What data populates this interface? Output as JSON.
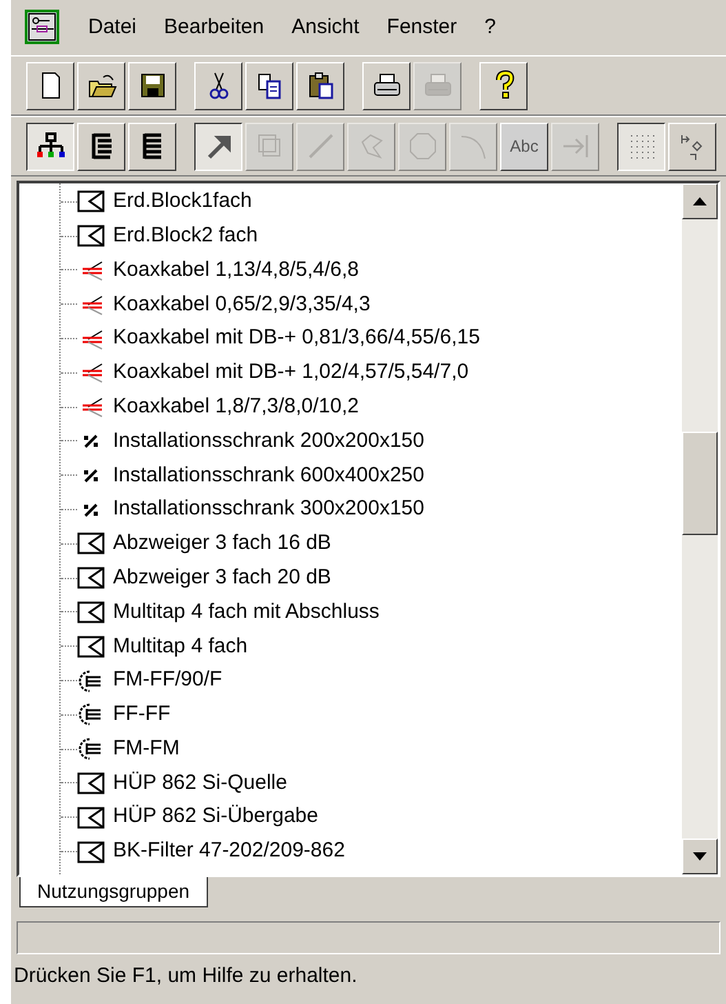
{
  "menu": [
    "Datei",
    "Bearbeiten",
    "Ansicht",
    "Fenster",
    "?"
  ],
  "toolbar_main": [
    [
      {
        "kind": "new",
        "disabled": false
      },
      {
        "kind": "open",
        "disabled": false
      },
      {
        "kind": "save",
        "disabled": false
      }
    ],
    [
      {
        "kind": "cut",
        "disabled": false
      },
      {
        "kind": "copy",
        "disabled": false
      },
      {
        "kind": "paste",
        "disabled": false
      }
    ],
    [
      {
        "kind": "print",
        "disabled": false
      },
      {
        "kind": "print",
        "disabled": true
      }
    ],
    [
      {
        "kind": "help",
        "disabled": false
      }
    ]
  ],
  "toolbar_draw": [
    [
      {
        "kind": "tree",
        "pressed": true,
        "disabled": false
      },
      {
        "kind": "list",
        "pressed": false,
        "disabled": false
      },
      {
        "kind": "bars",
        "pressed": false,
        "disabled": false
      }
    ],
    [
      {
        "kind": "pointer",
        "pressed": true,
        "disabled": false
      },
      {
        "kind": "frames",
        "pressed": false,
        "disabled": true
      },
      {
        "kind": "line",
        "pressed": false,
        "disabled": true
      },
      {
        "kind": "polygon",
        "pressed": false,
        "disabled": true
      },
      {
        "kind": "octagon",
        "pressed": false,
        "disabled": true
      },
      {
        "kind": "arc",
        "pressed": false,
        "disabled": true
      },
      {
        "kind": "text",
        "pressed": false,
        "disabled": true,
        "label": "Abc"
      },
      {
        "kind": "arrow",
        "pressed": false,
        "disabled": true
      }
    ],
    [
      {
        "kind": "grid",
        "pressed": true,
        "disabled": false
      },
      {
        "kind": "snap",
        "pressed": false,
        "disabled": false
      }
    ]
  ],
  "tree": {
    "items": [
      {
        "kind": "block",
        "label": "Erd.Block1fach"
      },
      {
        "kind": "block",
        "label": "Erd.Block2 fach"
      },
      {
        "kind": "cable",
        "label": "Koaxkabel 1,13/4,8/5,4/6,8"
      },
      {
        "kind": "cable",
        "label": "Koaxkabel 0,65/2,9/3,35/4,3"
      },
      {
        "kind": "cable",
        "label": "Koaxkabel mit DB-+ 0,81/3,66/4,55/6,15"
      },
      {
        "kind": "cable",
        "label": "Koaxkabel mit DB-+ 1,02/4,57/5,54/7,0"
      },
      {
        "kind": "cable",
        "label": "Koaxkabel 1,8/7,3/8,0/10,2"
      },
      {
        "kind": "cabinet",
        "label": "Installationsschrank 200x200x150"
      },
      {
        "kind": "cabinet",
        "label": "Installationsschrank 600x400x250"
      },
      {
        "kind": "cabinet",
        "label": "Installationsschrank 300x200x150"
      },
      {
        "kind": "block",
        "label": "Abzweiger  3 fach 16 dB"
      },
      {
        "kind": "block",
        "label": "Abzweiger  3 fach 20 dB"
      },
      {
        "kind": "block",
        "label": "Multitap 4 fach mit Abschluss"
      },
      {
        "kind": "block",
        "label": "Multitap 4 fach"
      },
      {
        "kind": "connector",
        "label": "FM-FF/90/F"
      },
      {
        "kind": "connector",
        "label": "FF-FF"
      },
      {
        "kind": "connector",
        "label": "FM-FM"
      },
      {
        "kind": "block",
        "label": "HÜP 862 Si-Quelle"
      },
      {
        "kind": "block",
        "label": "HÜP 862 Si-Übergabe"
      },
      {
        "kind": "block",
        "label": "BK-Filter 47-202/209-862"
      }
    ]
  },
  "tabs": [
    {
      "label": "Nutzungsgruppen",
      "selected": true
    }
  ],
  "status_bar": "Drücken Sie F1, um Hilfe zu erhalten."
}
